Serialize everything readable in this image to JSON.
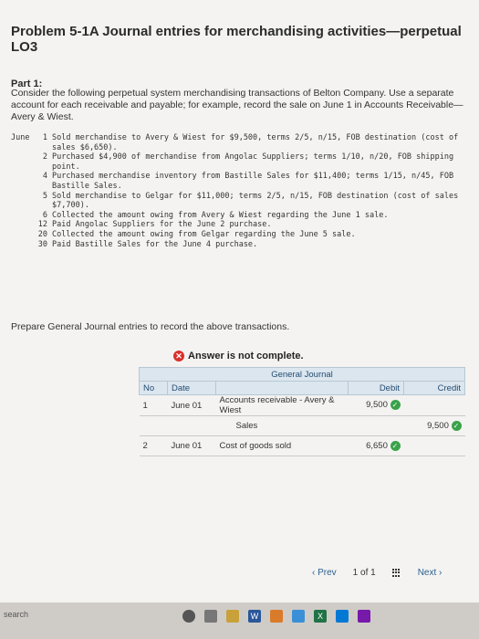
{
  "title": "Problem 5-1A Journal entries for merchandising activities—perpetual LO3",
  "part_label": "Part 1:",
  "intro": "Consider the following perpetual system merchandising transactions of Belton Company. Use a separate account for each receivable and payable; for example, record the sale on June 1 in Accounts Receivable—Avery & Wiest.",
  "transactions": [
    {
      "month": "June",
      "day": "1",
      "text": "Sold merchandise to Avery & Wiest for $9,500, terms 2/5, n/15, FOB destination (cost of sales $6,650)."
    },
    {
      "month": "",
      "day": "2",
      "text": "Purchased $4,900 of merchandise from Angolac Suppliers; terms 1/10, n/20, FOB shipping point."
    },
    {
      "month": "",
      "day": "4",
      "text": "Purchased merchandise inventory from Bastille Sales for $11,400; terms 1/15, n/45, FOB Bastille Sales."
    },
    {
      "month": "",
      "day": "5",
      "text": "Sold merchandise to Gelgar for $11,000; terms 2/5, n/15, FOB destination (cost of sales $7,700)."
    },
    {
      "month": "",
      "day": "6",
      "text": "Collected the amount owing from Avery & Wiest regarding the June 1 sale."
    },
    {
      "month": "",
      "day": "12",
      "text": "Paid Angolac Suppliers for the June 2 purchase."
    },
    {
      "month": "",
      "day": "20",
      "text": "Collected the amount owing from Gelgar regarding the June 5 sale."
    },
    {
      "month": "",
      "day": "30",
      "text": "Paid Bastille Sales for the June 4 purchase."
    }
  ],
  "instruction": "Prepare General Journal entries to record the above transactions.",
  "status": "Answer is not complete.",
  "journal": {
    "caption": "General Journal",
    "headers": {
      "no": "No",
      "date": "Date",
      "debit": "Debit",
      "credit": "Credit"
    },
    "rows": [
      {
        "no": "1",
        "date": "June 01",
        "account": "Accounts receivable - Avery & Wiest",
        "debit": "9,500",
        "credit": ""
      },
      {
        "no": "",
        "date": "",
        "account": "Sales",
        "debit": "",
        "credit": "9,500"
      },
      {
        "no": "2",
        "date": "June 01",
        "account": "Cost of goods sold",
        "debit": "6,650",
        "credit": ""
      }
    ]
  },
  "pager": {
    "prev": "Prev",
    "count": "1 of 1",
    "next": "Next"
  },
  "taskbar": {
    "search": "search"
  },
  "colors": {
    "accent": "#2b5f8f",
    "error": "#d9302c",
    "check": "#3aa24a",
    "header": "#dce6ef"
  }
}
